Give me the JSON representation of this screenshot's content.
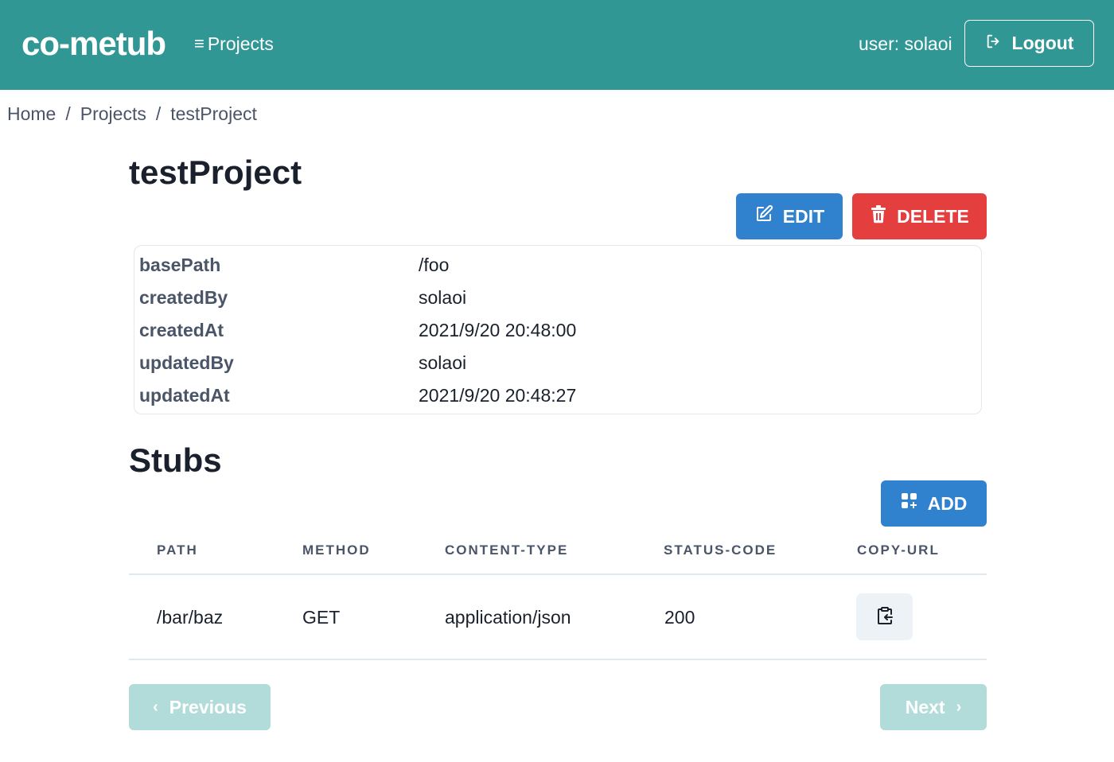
{
  "header": {
    "logo": "co-metub",
    "nav_projects": "Projects",
    "user_label": "user: solaoi",
    "logout_label": "Logout"
  },
  "breadcrumb": {
    "items": [
      "Home",
      "Projects",
      "testProject"
    ],
    "separator": "/"
  },
  "project": {
    "title": "testProject",
    "edit_label": "EDIT",
    "delete_label": "DELETE",
    "details": [
      {
        "key": "basePath",
        "value": "/foo"
      },
      {
        "key": "createdBy",
        "value": "solaoi"
      },
      {
        "key": "createdAt",
        "value": "2021/9/20 20:48:00"
      },
      {
        "key": "updatedBy",
        "value": "solaoi"
      },
      {
        "key": "updatedAt",
        "value": "2021/9/20 20:48:27"
      }
    ]
  },
  "stubs": {
    "title": "Stubs",
    "add_label": "ADD",
    "columns": [
      "PATH",
      "METHOD",
      "CONTENT-TYPE",
      "STATUS-CODE",
      "COPY-URL"
    ],
    "rows": [
      {
        "path": "/bar/baz",
        "method": "GET",
        "content_type": "application/json",
        "status_code": "200"
      }
    ]
  },
  "pagination": {
    "previous_label": "Previous",
    "next_label": "Next"
  },
  "colors": {
    "header_bg": "#319795",
    "primary": "#3182ce",
    "danger": "#e53e3e",
    "pagination_disabled": "#b2dcd9"
  },
  "icons": {
    "menu": "list-icon",
    "logout": "logout-icon",
    "edit": "edit-icon",
    "delete": "trash-icon",
    "add": "add-grid-icon",
    "copy": "clipboard-copy-icon",
    "prev": "chevron-left-icon",
    "next": "chevron-right-icon"
  }
}
